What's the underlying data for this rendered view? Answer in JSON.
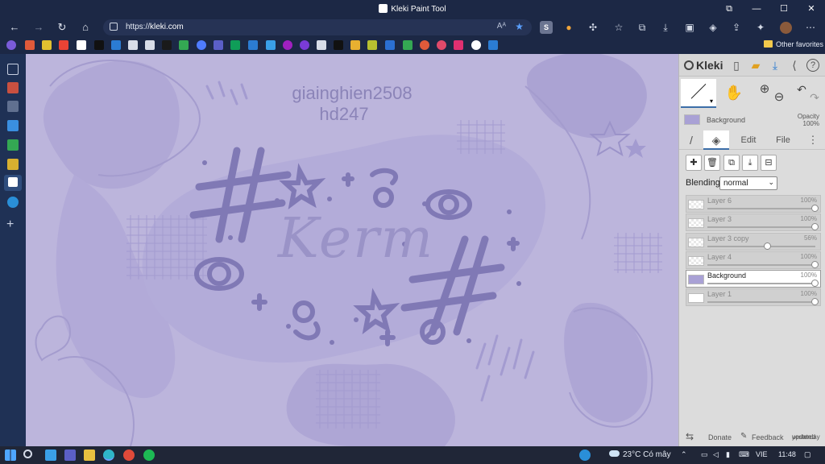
{
  "window": {
    "title": "Kleki Paint Tool",
    "controls": [
      "⧉",
      "—",
      "☐",
      "✕"
    ]
  },
  "browser": {
    "url_prefix": "https://",
    "url_domain": "kleki.com",
    "read_aloud": "Aᴬ",
    "favorites_other": "Other favorites",
    "toolbar_badge": "S"
  },
  "canvas": {
    "line1": "giainghien2508",
    "line2": "hd247",
    "artwork_text": "Kerm",
    "background_color": "#bcb5dc",
    "art_color": "#8079b5"
  },
  "kleki": {
    "logo": "Kleki",
    "layer_name": "Background",
    "opacity_label": "Opacity",
    "opacity_value": "100%",
    "tabs": [
      "Edit",
      "File"
    ],
    "blending_label": "Blending",
    "blending_value": "normal",
    "layers": [
      {
        "name": "Layer 6",
        "percent": "100%",
        "value": 100,
        "thumb": "transparent",
        "active": false
      },
      {
        "name": "Layer 3",
        "percent": "100%",
        "value": 100,
        "thumb": "transparent",
        "active": false
      },
      {
        "name": "Layer 3 copy",
        "percent": "56%",
        "value": 56,
        "thumb": "transparent",
        "active": false
      },
      {
        "name": "Layer 4",
        "percent": "100%",
        "value": 100,
        "thumb": "transparent",
        "active": false
      },
      {
        "name": "Background",
        "percent": "100%",
        "value": 100,
        "thumb": "bg",
        "active": true
      },
      {
        "name": "Layer 1",
        "percent": "100%",
        "value": 100,
        "thumb": "white",
        "active": false
      }
    ],
    "footer": {
      "donate": "Donate",
      "feedback": "Feedback",
      "updated_line1": "updated",
      "updated_line2": "yesterday"
    }
  },
  "taskbar": {
    "weather": "23°C  Có mây",
    "language": "VIE",
    "time": "11:48"
  }
}
